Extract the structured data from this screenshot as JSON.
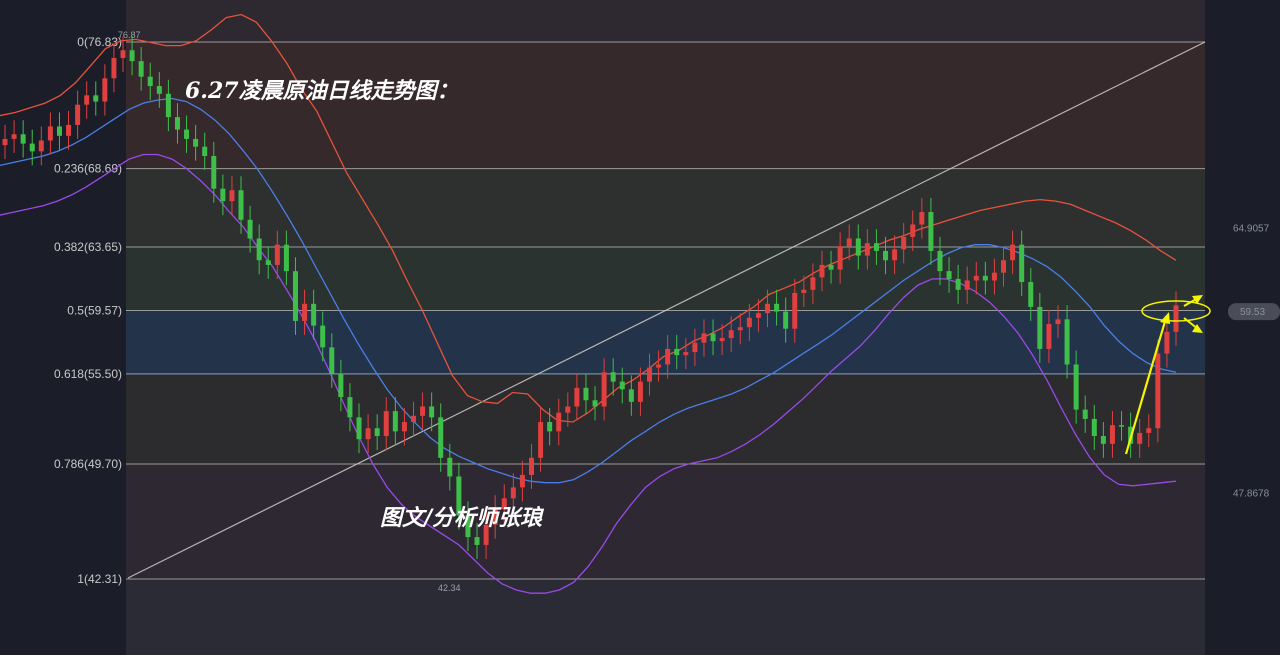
{
  "title": "6.27凌晨原油日线走势图：",
  "author": "图文/分析师张琅",
  "colors": {
    "background": "#1b1e28",
    "plot_background": "#2a2b33",
    "bull_candle": "#e0403f",
    "bear_candle": "#3ebf4a",
    "upper_band": "#e8523c",
    "mid_band": "#4a7fe8",
    "lower_band": "#9a4ae8",
    "fib_line": "#c0c0c0",
    "arrow": "#f5f500"
  },
  "chart_data": {
    "type": "candlestick",
    "title": "6.27凌晨原油日线走势图：",
    "ylim": [
      38.0,
      80.5
    ],
    "fib_levels": [
      {
        "label": "0(76.83)",
        "value": 76.83
      },
      {
        "label": "0.236(68.69)",
        "value": 68.69
      },
      {
        "label": "0.382(63.65)",
        "value": 63.65
      },
      {
        "label": "0.5(59.57)",
        "value": 59.57
      },
      {
        "label": "0.618(55.50)",
        "value": 55.5
      },
      {
        "label": "0.786(49.70)",
        "value": 49.7
      },
      {
        "label": "1(42.31)",
        "value": 42.31
      }
    ],
    "price_labels": [
      {
        "label": "76.87",
        "value": 76.87
      },
      {
        "label": "42.34",
        "value": 42.34
      },
      {
        "label": "64.9057",
        "value": 64.9057
      },
      {
        "label": "59.53",
        "value": 59.53
      },
      {
        "label": "47.8678",
        "value": 47.8678
      }
    ],
    "close": [
      70.6,
      70.9,
      70.3,
      69.8,
      70.5,
      71.4,
      70.8,
      71.5,
      72.8,
      73.4,
      73.0,
      74.5,
      75.8,
      76.3,
      75.6,
      74.6,
      74.0,
      73.5,
      72.0,
      71.2,
      70.6,
      70.1,
      69.5,
      67.4,
      66.6,
      67.3,
      65.4,
      64.2,
      62.8,
      62.5,
      63.8,
      62.1,
      58.9,
      60.0,
      58.6,
      57.2,
      55.5,
      54.0,
      52.7,
      51.3,
      52.0,
      51.5,
      53.1,
      51.8,
      52.4,
      52.8,
      53.4,
      52.7,
      50.1,
      48.9,
      46.4,
      45.0,
      44.5,
      45.8,
      46.8,
      47.5,
      48.2,
      49.0,
      50.1,
      52.4,
      51.8,
      53.0,
      53.4,
      54.6,
      53.8,
      53.4,
      55.6,
      55.0,
      54.5,
      53.7,
      55.0,
      55.9,
      56.1,
      57.1,
      56.7,
      56.9,
      57.5,
      58.1,
      57.6,
      57.8,
      58.3,
      58.5,
      59.1,
      59.4,
      60.0,
      59.5,
      58.4,
      60.7,
      60.9,
      61.7,
      62.5,
      62.2,
      63.7,
      64.2,
      63.1,
      63.9,
      63.4,
      62.8,
      63.5,
      64.3,
      65.1,
      65.9,
      63.4,
      62.1,
      61.6,
      60.9,
      61.5,
      61.8,
      61.5,
      62.0,
      62.8,
      63.8,
      61.4,
      59.8,
      57.1,
      58.7,
      59.0,
      56.1,
      53.2,
      52.6,
      51.5,
      51.0,
      52.2,
      52.1,
      51.0,
      51.7,
      52.0,
      56.8,
      58.2,
      59.9
    ],
    "open": [
      70.2,
      70.6,
      70.9,
      70.3,
      69.8,
      70.5,
      71.4,
      70.8,
      71.5,
      72.8,
      73.4,
      73.0,
      74.5,
      75.8,
      76.3,
      75.6,
      74.6,
      74.0,
      73.5,
      72.0,
      71.2,
      70.6,
      70.1,
      69.5,
      67.4,
      66.6,
      67.3,
      65.4,
      64.2,
      62.8,
      62.5,
      63.8,
      62.1,
      58.9,
      60.0,
      58.6,
      57.2,
      55.5,
      54.0,
      52.7,
      51.3,
      52.0,
      51.5,
      53.1,
      51.8,
      52.4,
      52.8,
      53.4,
      52.7,
      50.1,
      48.9,
      46.4,
      45.0,
      44.5,
      45.8,
      46.8,
      47.5,
      48.2,
      49.0,
      50.1,
      52.4,
      51.8,
      53.0,
      53.4,
      54.6,
      53.8,
      53.4,
      55.6,
      55.0,
      54.5,
      53.7,
      55.0,
      55.9,
      56.1,
      57.1,
      56.7,
      56.9,
      57.5,
      58.1,
      57.6,
      57.8,
      58.3,
      58.5,
      59.1,
      59.4,
      60.0,
      59.5,
      58.4,
      60.7,
      60.9,
      61.7,
      62.5,
      62.2,
      63.7,
      64.2,
      63.1,
      63.9,
      63.4,
      62.8,
      63.5,
      64.3,
      65.1,
      65.9,
      63.4,
      62.1,
      61.6,
      60.9,
      61.5,
      61.8,
      61.5,
      62.0,
      62.8,
      63.8,
      61.4,
      59.8,
      57.1,
      58.7,
      59.0,
      56.1,
      53.2,
      52.6,
      51.5,
      51.0,
      52.2,
      52.1,
      51.0,
      51.7,
      52.0,
      56.8,
      58.2
    ],
    "upper_band": [
      72.1,
      72.3,
      72.6,
      72.9,
      73.4,
      74.2,
      75.3,
      76.4,
      76.9,
      77.0,
      76.8,
      76.6,
      76.6,
      76.9,
      77.6,
      78.4,
      78.6,
      78.1,
      76.9,
      75.5,
      73.8,
      72.4,
      70.4,
      68.4,
      66.8,
      65.2,
      63.5,
      61.5,
      59.6,
      57.5,
      55.4,
      54.1,
      53.7,
      53.6,
      54.3,
      54.2,
      53.2,
      52.5,
      52.4,
      53.0,
      53.8,
      54.6,
      55.1,
      55.8,
      56.6,
      57.0,
      57.6,
      58.0,
      58.5,
      59.2,
      59.8,
      60.6,
      61.0,
      61.4,
      62.0,
      62.5,
      62.9,
      63.3,
      63.7,
      64.1,
      64.4,
      64.8,
      65.1,
      65.4,
      65.7,
      66.0,
      66.2,
      66.4,
      66.6,
      66.7,
      66.6,
      66.4,
      66.0,
      65.6,
      65.2,
      64.7,
      64.1,
      63.4,
      62.8
    ],
    "mid_band": [
      68.9,
      69.1,
      69.3,
      69.5,
      69.8,
      70.2,
      70.7,
      71.3,
      71.9,
      72.5,
      72.9,
      73.1,
      73.2,
      73.0,
      72.5,
      71.8,
      70.9,
      69.8,
      68.6,
      67.2,
      65.7,
      64.1,
      62.4,
      60.7,
      59.0,
      57.4,
      55.9,
      54.5,
      53.3,
      52.3,
      51.4,
      50.7,
      50.2,
      49.8,
      49.4,
      49.1,
      48.8,
      48.6,
      48.5,
      48.5,
      48.7,
      49.2,
      49.8,
      50.5,
      51.2,
      51.8,
      52.4,
      52.9,
      53.3,
      53.6,
      53.9,
      54.2,
      54.6,
      55.1,
      55.6,
      56.2,
      56.8,
      57.4,
      58.0,
      58.7,
      59.4,
      60.1,
      60.8,
      61.5,
      62.1,
      62.7,
      63.2,
      63.6,
      63.8,
      63.8,
      63.6,
      63.3,
      62.9,
      62.4,
      61.7,
      60.8,
      59.8,
      58.6,
      57.6,
      56.8,
      56.2,
      55.8,
      55.6
    ],
    "lower_band": [
      65.7,
      65.9,
      66.1,
      66.3,
      66.6,
      67.0,
      67.5,
      68.1,
      68.7,
      69.3,
      69.6,
      69.6,
      69.3,
      68.7,
      67.9,
      67.0,
      65.9,
      64.9,
      63.6,
      62.4,
      60.9,
      59.3,
      57.6,
      55.6,
      53.5,
      51.5,
      49.7,
      48.2,
      47.1,
      46.3,
      45.7,
      45.1,
      44.5,
      43.6,
      42.7,
      42.0,
      41.6,
      41.4,
      41.4,
      41.6,
      42.1,
      43.1,
      44.4,
      45.9,
      47.1,
      48.2,
      48.9,
      49.4,
      49.7,
      49.9,
      50.1,
      50.5,
      51.0,
      51.6,
      52.3,
      53.1,
      53.9,
      54.8,
      55.7,
      56.5,
      57.3,
      58.3,
      59.4,
      60.4,
      61.2,
      61.6,
      61.6,
      61.3,
      60.8,
      60.1,
      59.2,
      58.1,
      56.7,
      55.1,
      53.3,
      51.6,
      50.1,
      49.0,
      48.4,
      48.3,
      48.4,
      48.5,
      48.6
    ]
  }
}
